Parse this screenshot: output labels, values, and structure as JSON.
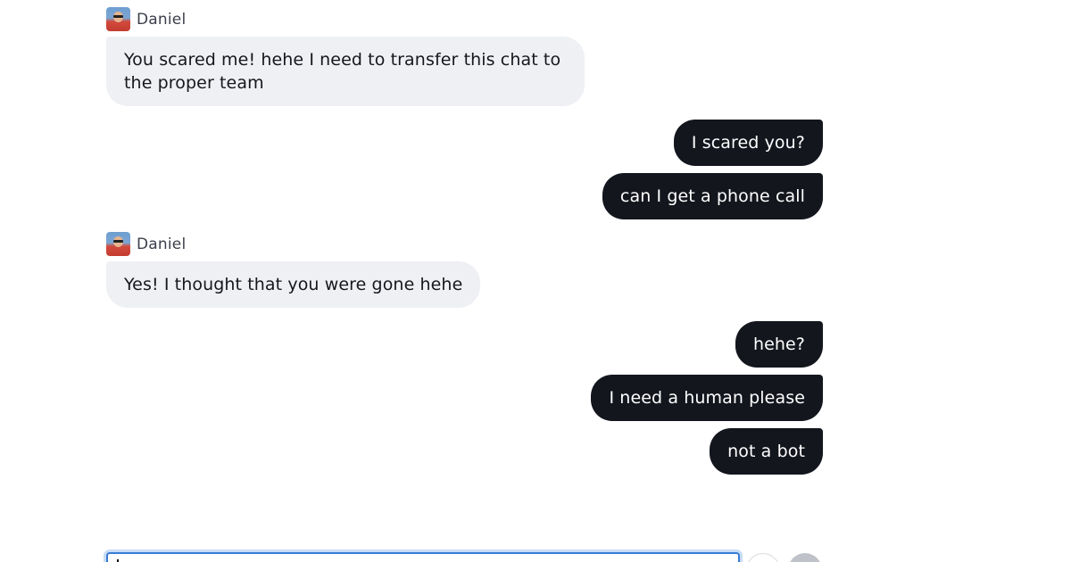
{
  "conversation": {
    "agent_name": "Daniel",
    "messages": [
      {
        "from": "agent",
        "text": "You scared me! hehe I need to transfer this chat to the proper team"
      },
      {
        "from": "user",
        "text": "I scared you?"
      },
      {
        "from": "user",
        "text": "can I get a phone call"
      },
      {
        "from": "agent",
        "text": "Yes! I thought that you were gone hehe"
      },
      {
        "from": "user",
        "text": "hehe?"
      },
      {
        "from": "user",
        "text": "I need a human please"
      },
      {
        "from": "user",
        "text": "not a bot"
      }
    ]
  },
  "composer": {
    "value": "",
    "emoji_icon": "smiley-icon",
    "send_icon": "send-icon"
  },
  "colors": {
    "agent_bubble": "#eef0f3",
    "user_bubble": "#14161e",
    "focus_ring": "#3a7bd5"
  }
}
